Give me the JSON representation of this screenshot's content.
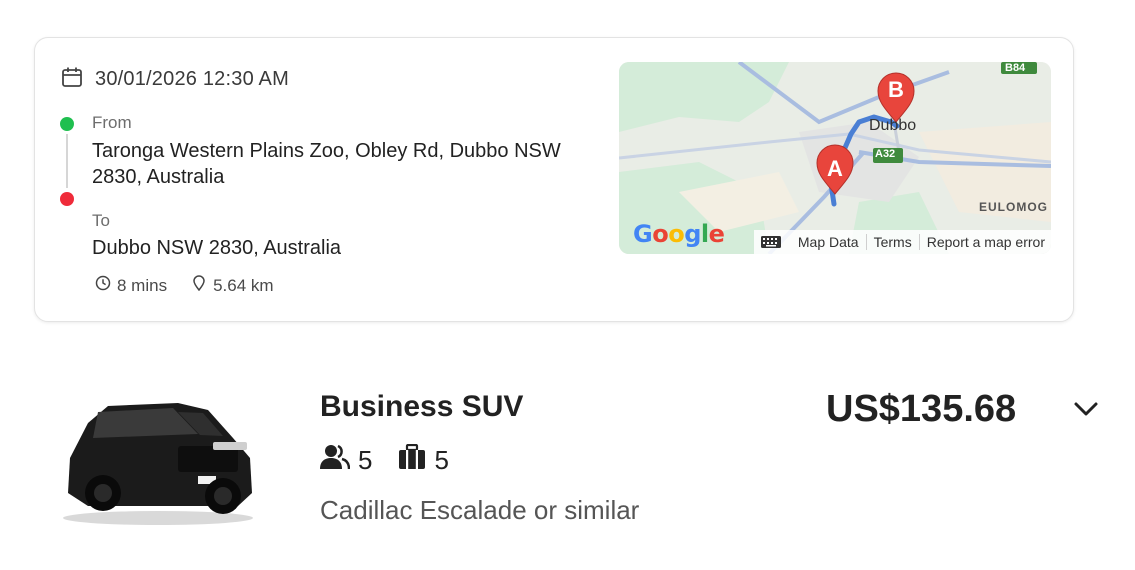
{
  "trip": {
    "datetime": "30/01/2026 12:30 AM",
    "from_label": "From",
    "from_address": "Taronga Western Plains Zoo, Obley Rd, Dubbo NSW 2830, Australia",
    "to_label": "To",
    "to_address": "Dubbo NSW 2830, Australia",
    "duration": "8 mins",
    "distance": "5.64 km"
  },
  "map": {
    "marker_a": "A",
    "marker_b": "B",
    "place_dubbo": "Dubbo",
    "road_a32": "A32",
    "road_b84": "B84",
    "place_eulomog": "EULOMOG",
    "logo_text": "Google",
    "map_data_label": "Map Data",
    "terms_label": "Terms",
    "report_label": "Report a map error"
  },
  "vehicle": {
    "name": "Business SUV",
    "passengers": "5",
    "luggage": "5",
    "model": "Cadillac Escalade or similar",
    "price": "US$135.68"
  },
  "colors": {
    "start_dot": "#1fbf4f",
    "end_dot": "#ef2b3a",
    "route": "#4a7fd4",
    "marker": "#e8453c"
  }
}
